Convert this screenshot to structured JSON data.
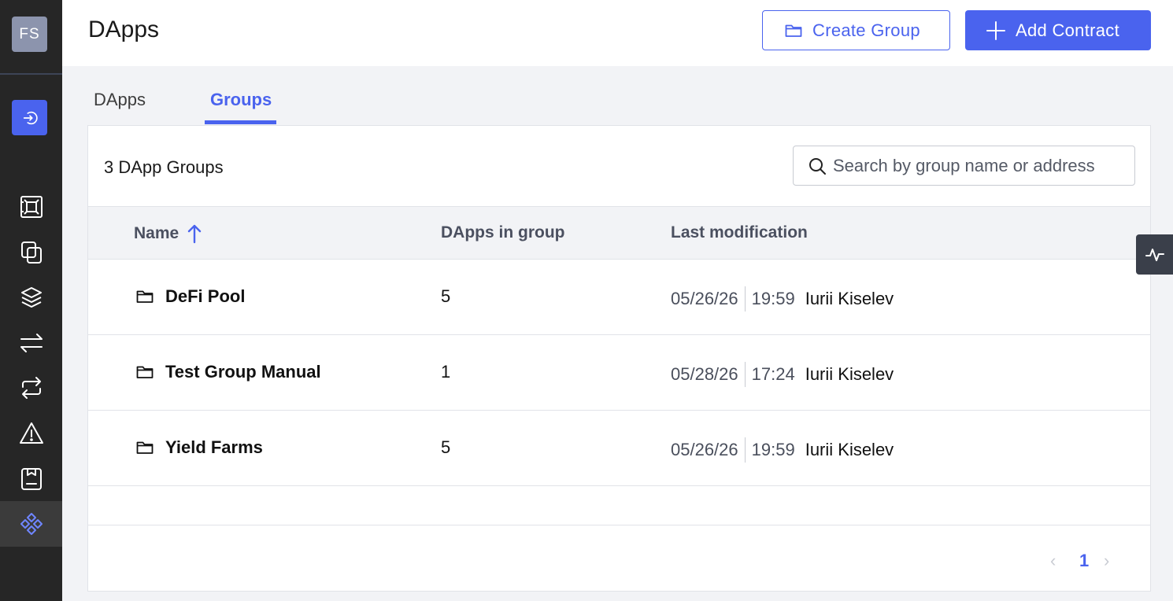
{
  "user": {
    "initials": "FS"
  },
  "header": {
    "title": "DApps",
    "create_group_label": "Create Group",
    "add_contract_label": "Add Contract"
  },
  "sidebar": {
    "items": [
      {
        "icon": "vault-icon"
      },
      {
        "icon": "copy-icon"
      },
      {
        "icon": "layers-icon"
      },
      {
        "icon": "transfer-arrows-icon"
      },
      {
        "icon": "repeat-icon"
      },
      {
        "icon": "warning-icon"
      },
      {
        "icon": "report-icon"
      },
      {
        "icon": "dapps-icon",
        "active": true
      }
    ]
  },
  "tabs": [
    {
      "label": "DApps",
      "active": false
    },
    {
      "label": "Groups",
      "active": true
    }
  ],
  "groups": {
    "count_label": "3 DApp Groups",
    "search_placeholder": "Search by group name or address",
    "columns": {
      "name": "Name",
      "count": "DApps in group",
      "modified": "Last modification"
    },
    "rows": [
      {
        "name": "DeFi Pool",
        "count": "5",
        "date": "05/26/26",
        "time": "19:59",
        "user": "Iurii Kiselev"
      },
      {
        "name": "Test Group Manual",
        "count": "1",
        "date": "05/28/26",
        "time": "17:24",
        "user": "Iurii Kiselev"
      },
      {
        "name": "Yield Farms",
        "count": "5",
        "date": "05/26/26",
        "time": "19:59",
        "user": "Iurii Kiselev"
      }
    ]
  },
  "pagination": {
    "prev": "‹",
    "current": "1",
    "next": "›"
  },
  "colors": {
    "accent": "#4a63ee",
    "sidebar_bg": "#262626",
    "page_bg": "#f2f3f6"
  }
}
